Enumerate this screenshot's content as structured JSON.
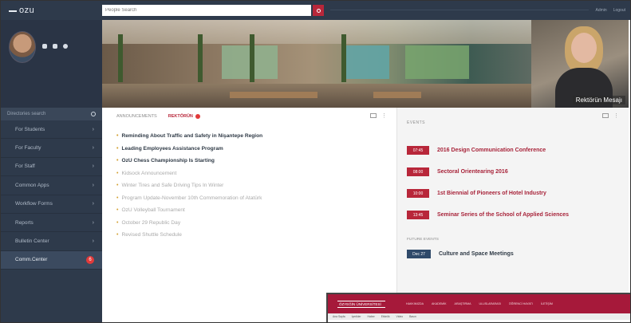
{
  "sidebar": {
    "logo": "ozu",
    "search_placeholder": "Directories search",
    "items": [
      {
        "label": "For Students"
      },
      {
        "label": "For Faculty"
      },
      {
        "label": "For Staff"
      },
      {
        "label": "Common Apps"
      },
      {
        "label": "Workflow Forms"
      },
      {
        "label": "Reports"
      },
      {
        "label": "Bulletin Center"
      },
      {
        "label": "Comm.Center",
        "badge": "6"
      }
    ]
  },
  "topbar": {
    "search_placeholder": "People Search",
    "links": [
      "Admin",
      "Logout"
    ]
  },
  "banner": {
    "caption": "Rektörün Mesajı"
  },
  "announcements": {
    "tabs": [
      "ANNOUNCEMENTS",
      "REKTÖRÜN"
    ],
    "items": [
      {
        "text": "Reminding About Traffic and Safety in Nişantepe Region",
        "bold": true
      },
      {
        "text": "Leading Employees Assistance Program",
        "bold": true
      },
      {
        "text": "OzU Chess Championship Is Starting",
        "bold": true
      },
      {
        "text": "Kidsock Announcement",
        "bold": false
      },
      {
        "text": "Winter Tires and Safe Driving Tips In Winter",
        "bold": false
      },
      {
        "text": "Program Update-November 10th Commemoration of Atatürk",
        "bold": false
      },
      {
        "text": "OzU Volleyball Tournament",
        "bold": false
      },
      {
        "text": "October 29 Republic Day",
        "bold": false
      },
      {
        "text": "Revised Shuttle Schedule",
        "bold": false
      }
    ]
  },
  "events": {
    "title": "EVENTS",
    "items": [
      {
        "time": "07:45",
        "title": "2016 Design Communication Conference"
      },
      {
        "time": "08:00",
        "title": "Sectoral Orientearing 2016"
      },
      {
        "time": "10:00",
        "title": "1st Biennial of Pioneers of Hotel Industry"
      },
      {
        "time": "13:45",
        "title": "Seminar Series of the School of Applied Sciences"
      }
    ],
    "upcoming_label": "FUTURE EVENTS",
    "upcoming": {
      "date": "Dec 27",
      "title": "Culture and Space Meetings"
    }
  },
  "overlay": {
    "logo_text": "ÖZYEĞİN ÜNİVERSİTESİ",
    "menu": [
      "HAKKIMIZDA",
      "AKADEMİK",
      "ARAŞTIRMA",
      "ULUSLARARASI",
      "ÖĞRENCİ HAYATI",
      "İLETİŞİM"
    ],
    "sub": [
      "Ana Sayfa",
      "İçerikler",
      "Haber",
      "Etkinlik",
      "Video",
      "Basın"
    ]
  }
}
